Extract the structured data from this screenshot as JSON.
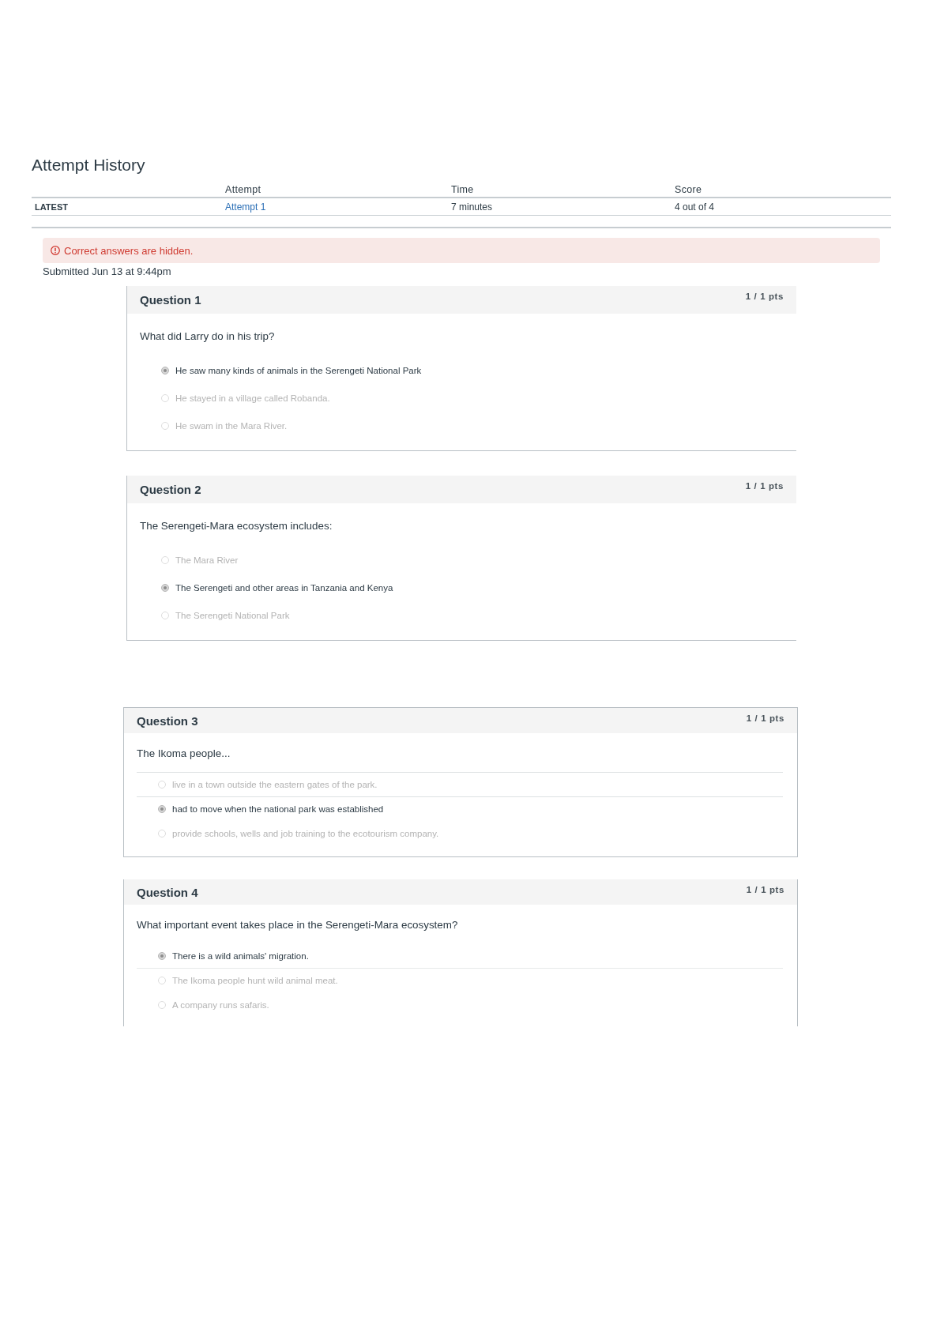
{
  "page": {
    "title": "Attempt History"
  },
  "attempt_history": {
    "columns": [
      "Attempt",
      "Time",
      "Score"
    ],
    "rows": [
      {
        "label": "LATEST",
        "cells": [
          {
            "text": "Attempt 1",
            "kind": "link"
          },
          {
            "text": "7 minutes",
            "kind": "text"
          },
          {
            "text": "4 out of 4",
            "kind": "text"
          }
        ]
      }
    ]
  },
  "alert": {
    "text": "Correct answers are hidden."
  },
  "submitted": "Submitted Jun 13 at 9:44pm",
  "questions": [
    {
      "title": "Question 1",
      "points": "1 / 1 pts",
      "text": "What did Larry do in his trip?",
      "answers": [
        {
          "text": "He saw many kinds of animals in the Serengeti National Park",
          "selected": true
        },
        {
          "text": "He stayed in a village called Robanda.",
          "selected": false
        },
        {
          "text": "He swam in the Mara River.",
          "selected": false
        }
      ]
    },
    {
      "title": "Question 2",
      "points": "1 / 1 pts",
      "text": "The Serengeti-Mara ecosystem includes:",
      "answers": [
        {
          "text": "The Mara River",
          "selected": false
        },
        {
          "text": "The Serengeti and other areas in Tanzania and Kenya",
          "selected": true
        },
        {
          "text": "The Serengeti National Park",
          "selected": false
        }
      ]
    },
    {
      "title": "Question 3",
      "points": "1 / 1 pts",
      "text": "The Ikoma people...",
      "answers": [
        {
          "text": "live in a town outside the eastern gates of the park.",
          "selected": false
        },
        {
          "text": "had to move when the national park was established",
          "selected": true
        },
        {
          "text": "provide schools, wells and job training to the ecotourism company.",
          "selected": false
        }
      ]
    },
    {
      "title": "Question 4",
      "points": "1 / 1 pts",
      "text": "What important event takes place in the Serengeti-Mara ecosystem?",
      "answers": [
        {
          "text": "There is a wild animals' migration.",
          "selected": true
        },
        {
          "text": "The Ikoma people hunt wild animal meat.",
          "selected": false
        },
        {
          "text": "A company runs safaris.",
          "selected": false
        }
      ]
    }
  ]
}
